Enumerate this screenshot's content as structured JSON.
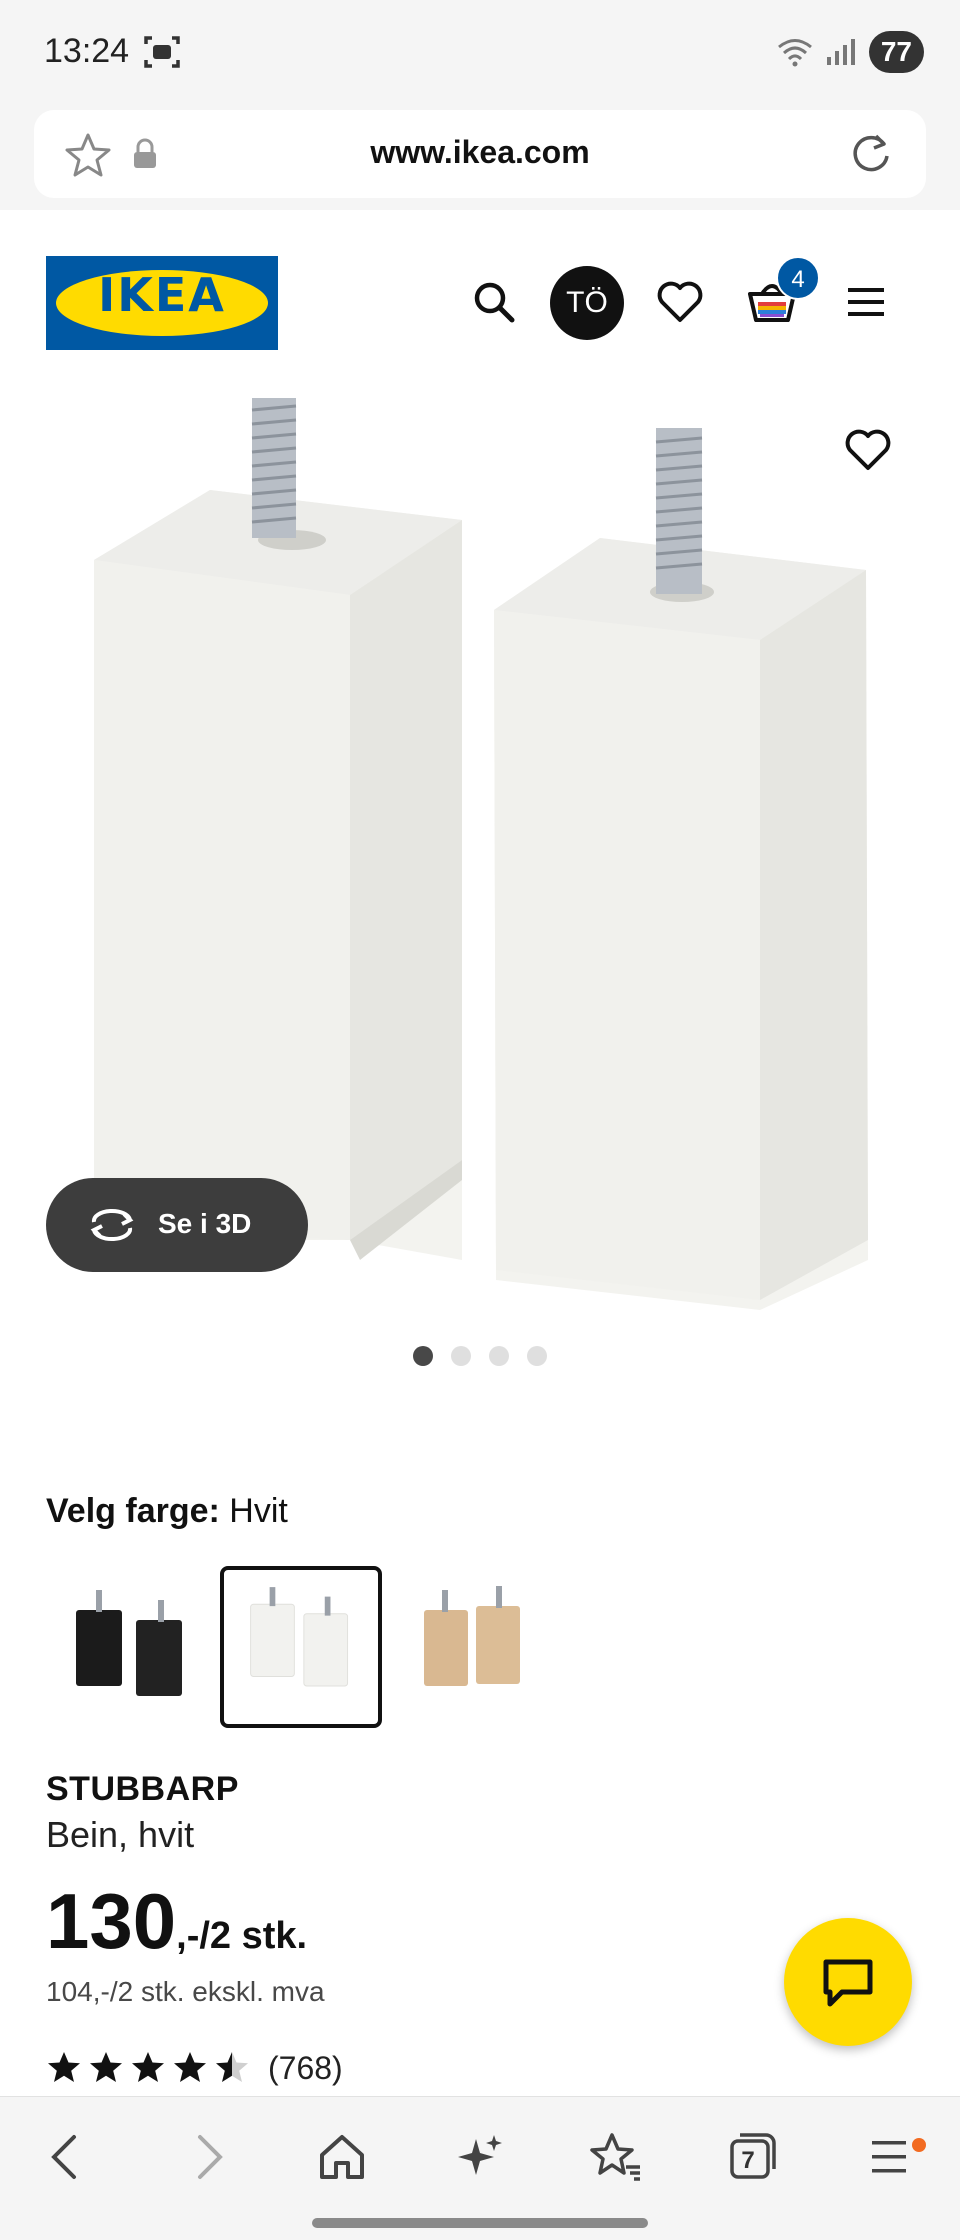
{
  "status_bar": {
    "time": "13:24",
    "battery": "77"
  },
  "browser": {
    "url": "www.ikea.com",
    "tabs_count": "7"
  },
  "header": {
    "logo_text": "IKEA",
    "user_initials": "TÖ",
    "cart_count": "4"
  },
  "gallery": {
    "view_3d_label": "Se i 3D",
    "image_count": 4,
    "active_index": 0
  },
  "color_picker": {
    "label": "Velg farge:",
    "selected": "Hvit",
    "options": [
      "Svart",
      "Hvit",
      "Bjørk"
    ]
  },
  "product": {
    "name": "STUBBARP",
    "description": "Bein, hvit",
    "price_main": "130",
    "price_suffix": ",-/2 stk.",
    "price_ex_vat": "104,-/2 stk. ekskl. mva",
    "rating": 4.5,
    "review_count": "(768)"
  },
  "colors": {
    "ikea_blue": "#0058a3",
    "ikea_yellow": "#ffdb00",
    "notification_dot": "#f26b21"
  },
  "icons": {
    "url_bar": [
      "star-icon",
      "lock-icon",
      "reload-icon"
    ],
    "header": [
      "search-icon",
      "heart-icon",
      "cart-icon",
      "menu-icon"
    ],
    "bottom_nav": [
      "back-icon",
      "forward-icon",
      "home-icon",
      "sparkle-icon",
      "favorites-icon",
      "tabs-icon",
      "menu-icon"
    ]
  }
}
